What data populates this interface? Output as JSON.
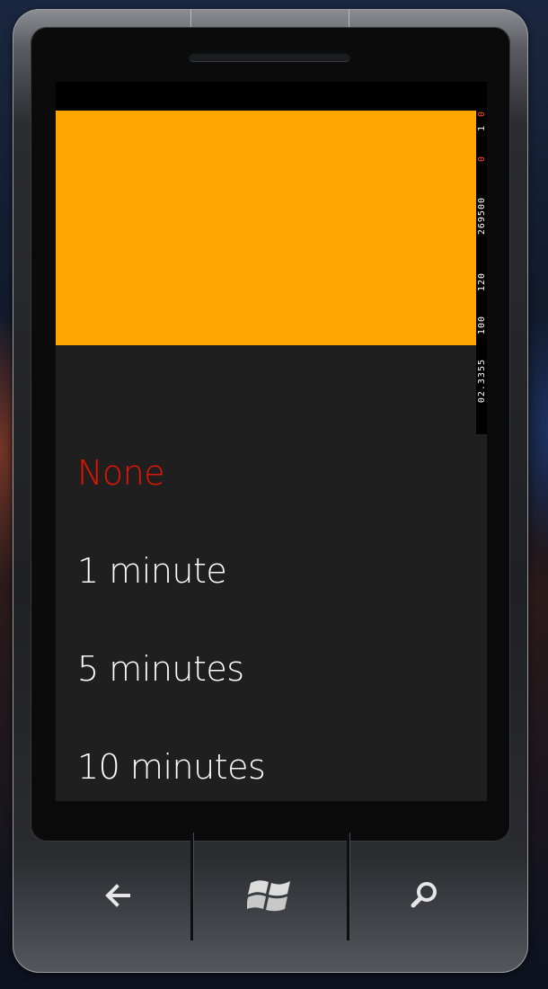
{
  "screen": {
    "header_color": "#ffa500",
    "selected_color": "#e51400",
    "background_color": "#1f1f1f"
  },
  "frame_rate_counters": [
    {
      "text": "0",
      "red": true
    },
    {
      "text": "1",
      "red": false
    },
    {
      "text": "0",
      "red": true
    },
    {
      "text": "269500",
      "red": false
    },
    {
      "text": "120",
      "red": false
    },
    {
      "text": "100",
      "red": false
    },
    {
      "text": "02.3355",
      "red": false
    }
  ],
  "picker_items": [
    {
      "label": "None",
      "selected": true
    },
    {
      "label": "1 minute",
      "selected": false
    },
    {
      "label": "5 minutes",
      "selected": false
    },
    {
      "label": "10 minutes",
      "selected": false
    }
  ],
  "hardware_buttons": {
    "back_icon": "back-arrow-icon",
    "start_icon": "windows-logo-icon",
    "search_icon": "search-icon"
  }
}
